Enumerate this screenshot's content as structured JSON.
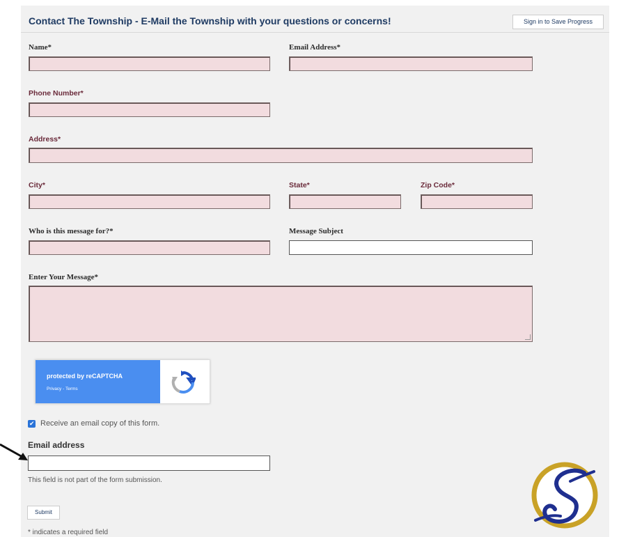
{
  "header": {
    "title": "Contact The Township - E-Mail the Township with your questions or concerns!",
    "signin_label": "Sign in to Save Progress"
  },
  "form": {
    "name_label": "Name*",
    "email_label": "Email Address*",
    "phone_label": "Phone Number*",
    "address_label": "Address*",
    "city_label": "City*",
    "state_label": "State*",
    "zip_label": "Zip Code*",
    "recipient_label": "Who is this message for?*",
    "subject_label": "Message Subject",
    "message_label": "Enter Your Message*"
  },
  "captcha": {
    "text": "protected by reCAPTCHA",
    "links": "Privacy - Terms",
    "icon": "recaptcha-icon"
  },
  "copy": {
    "checkbox_label": "Receive an email copy of this form.",
    "checked": true,
    "email_label": "Email address",
    "note": "This field is not part of the form submission."
  },
  "footer": {
    "submit_label": "Submit",
    "required_note": "* indicates a required field"
  },
  "colors": {
    "required_field_bg": "#f2dcdf",
    "panel_bg": "#f1f1f1",
    "title": "#1f3b63",
    "captcha_blue": "#4a8ef0",
    "logo_gold": "#c9a227",
    "logo_blue": "#1f2f8f"
  },
  "icons": {
    "arrow": "arrow-pointer-icon",
    "logo": "township-s-logo"
  }
}
